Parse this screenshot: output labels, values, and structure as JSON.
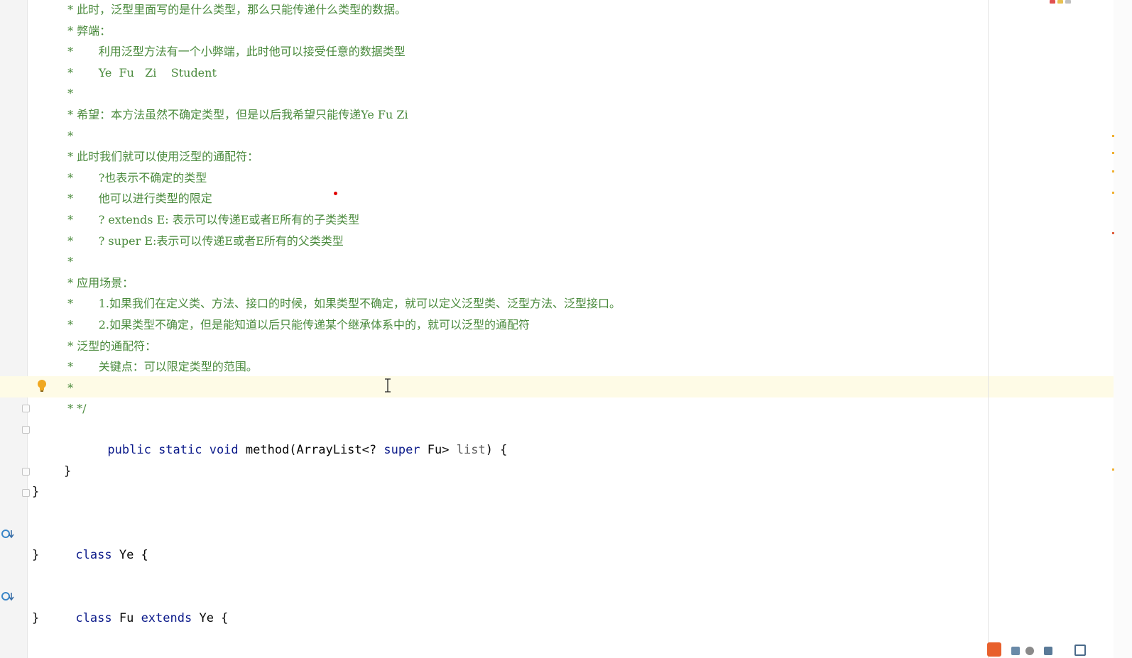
{
  "comment_lines": [
    {
      "text": " * 此时，泛型里面写的是什么类型，那么只能传递什么类型的数据。"
    },
    {
      "text": " * 弊端："
    },
    {
      "text": " *       利用泛型方法有一个小弊端，此时他可以接受任意的数据类型"
    },
    {
      "text": " *       Ye  Fu   Zi    Student"
    },
    {
      "text": " *"
    },
    {
      "text": " * 希望：本方法虽然不确定类型，但是以后我希望只能传递Ye Fu Zi"
    },
    {
      "text": " *"
    },
    {
      "text": " * 此时我们就可以使用泛型的通配符："
    },
    {
      "text": " *       ?也表示不确定的类型"
    },
    {
      "text": " *       他可以进行类型的限定"
    },
    {
      "text": " *       ? extends E: 表示可以传递E或者E所有的子类类型"
    },
    {
      "text": " *       ? super E:表示可以传递E或者E所有的父类类型"
    },
    {
      "text": " *"
    },
    {
      "text": " * 应用场景："
    },
    {
      "text": " *       1.如果我们在定义类、方法、接口的时候，如果类型不确定，就可以定义泛型类、泛型方法、泛型接口。"
    },
    {
      "text": " *       2.如果类型不确定，但是能知道以后只能传递某个继承体系中的，就可以泛型的通配符"
    },
    {
      "text": " * 泛型的通配符："
    },
    {
      "text": " *       关键点：可以限定类型的范围。"
    },
    {
      "text": " *"
    },
    {
      "text": " * */"
    }
  ],
  "method": {
    "modifiers": "public static void",
    "name": " method(ArrayList<? ",
    "super_kw": "super",
    "type_rest": " Fu> ",
    "param": "list",
    "open": ") {",
    "close_inner": "}",
    "close_outer": "}"
  },
  "class_ye": {
    "keyword": "class",
    "rest": " Ye {",
    "close": "}"
  },
  "class_fu": {
    "keyword": "class",
    "name": " Fu ",
    "extends_kw": "extends",
    "rest": " Ye {",
    "close": "}"
  },
  "colors": {
    "comment": "#4a8a3c",
    "keyword": "#0b1a8a",
    "current_line": "#fefbe6"
  }
}
